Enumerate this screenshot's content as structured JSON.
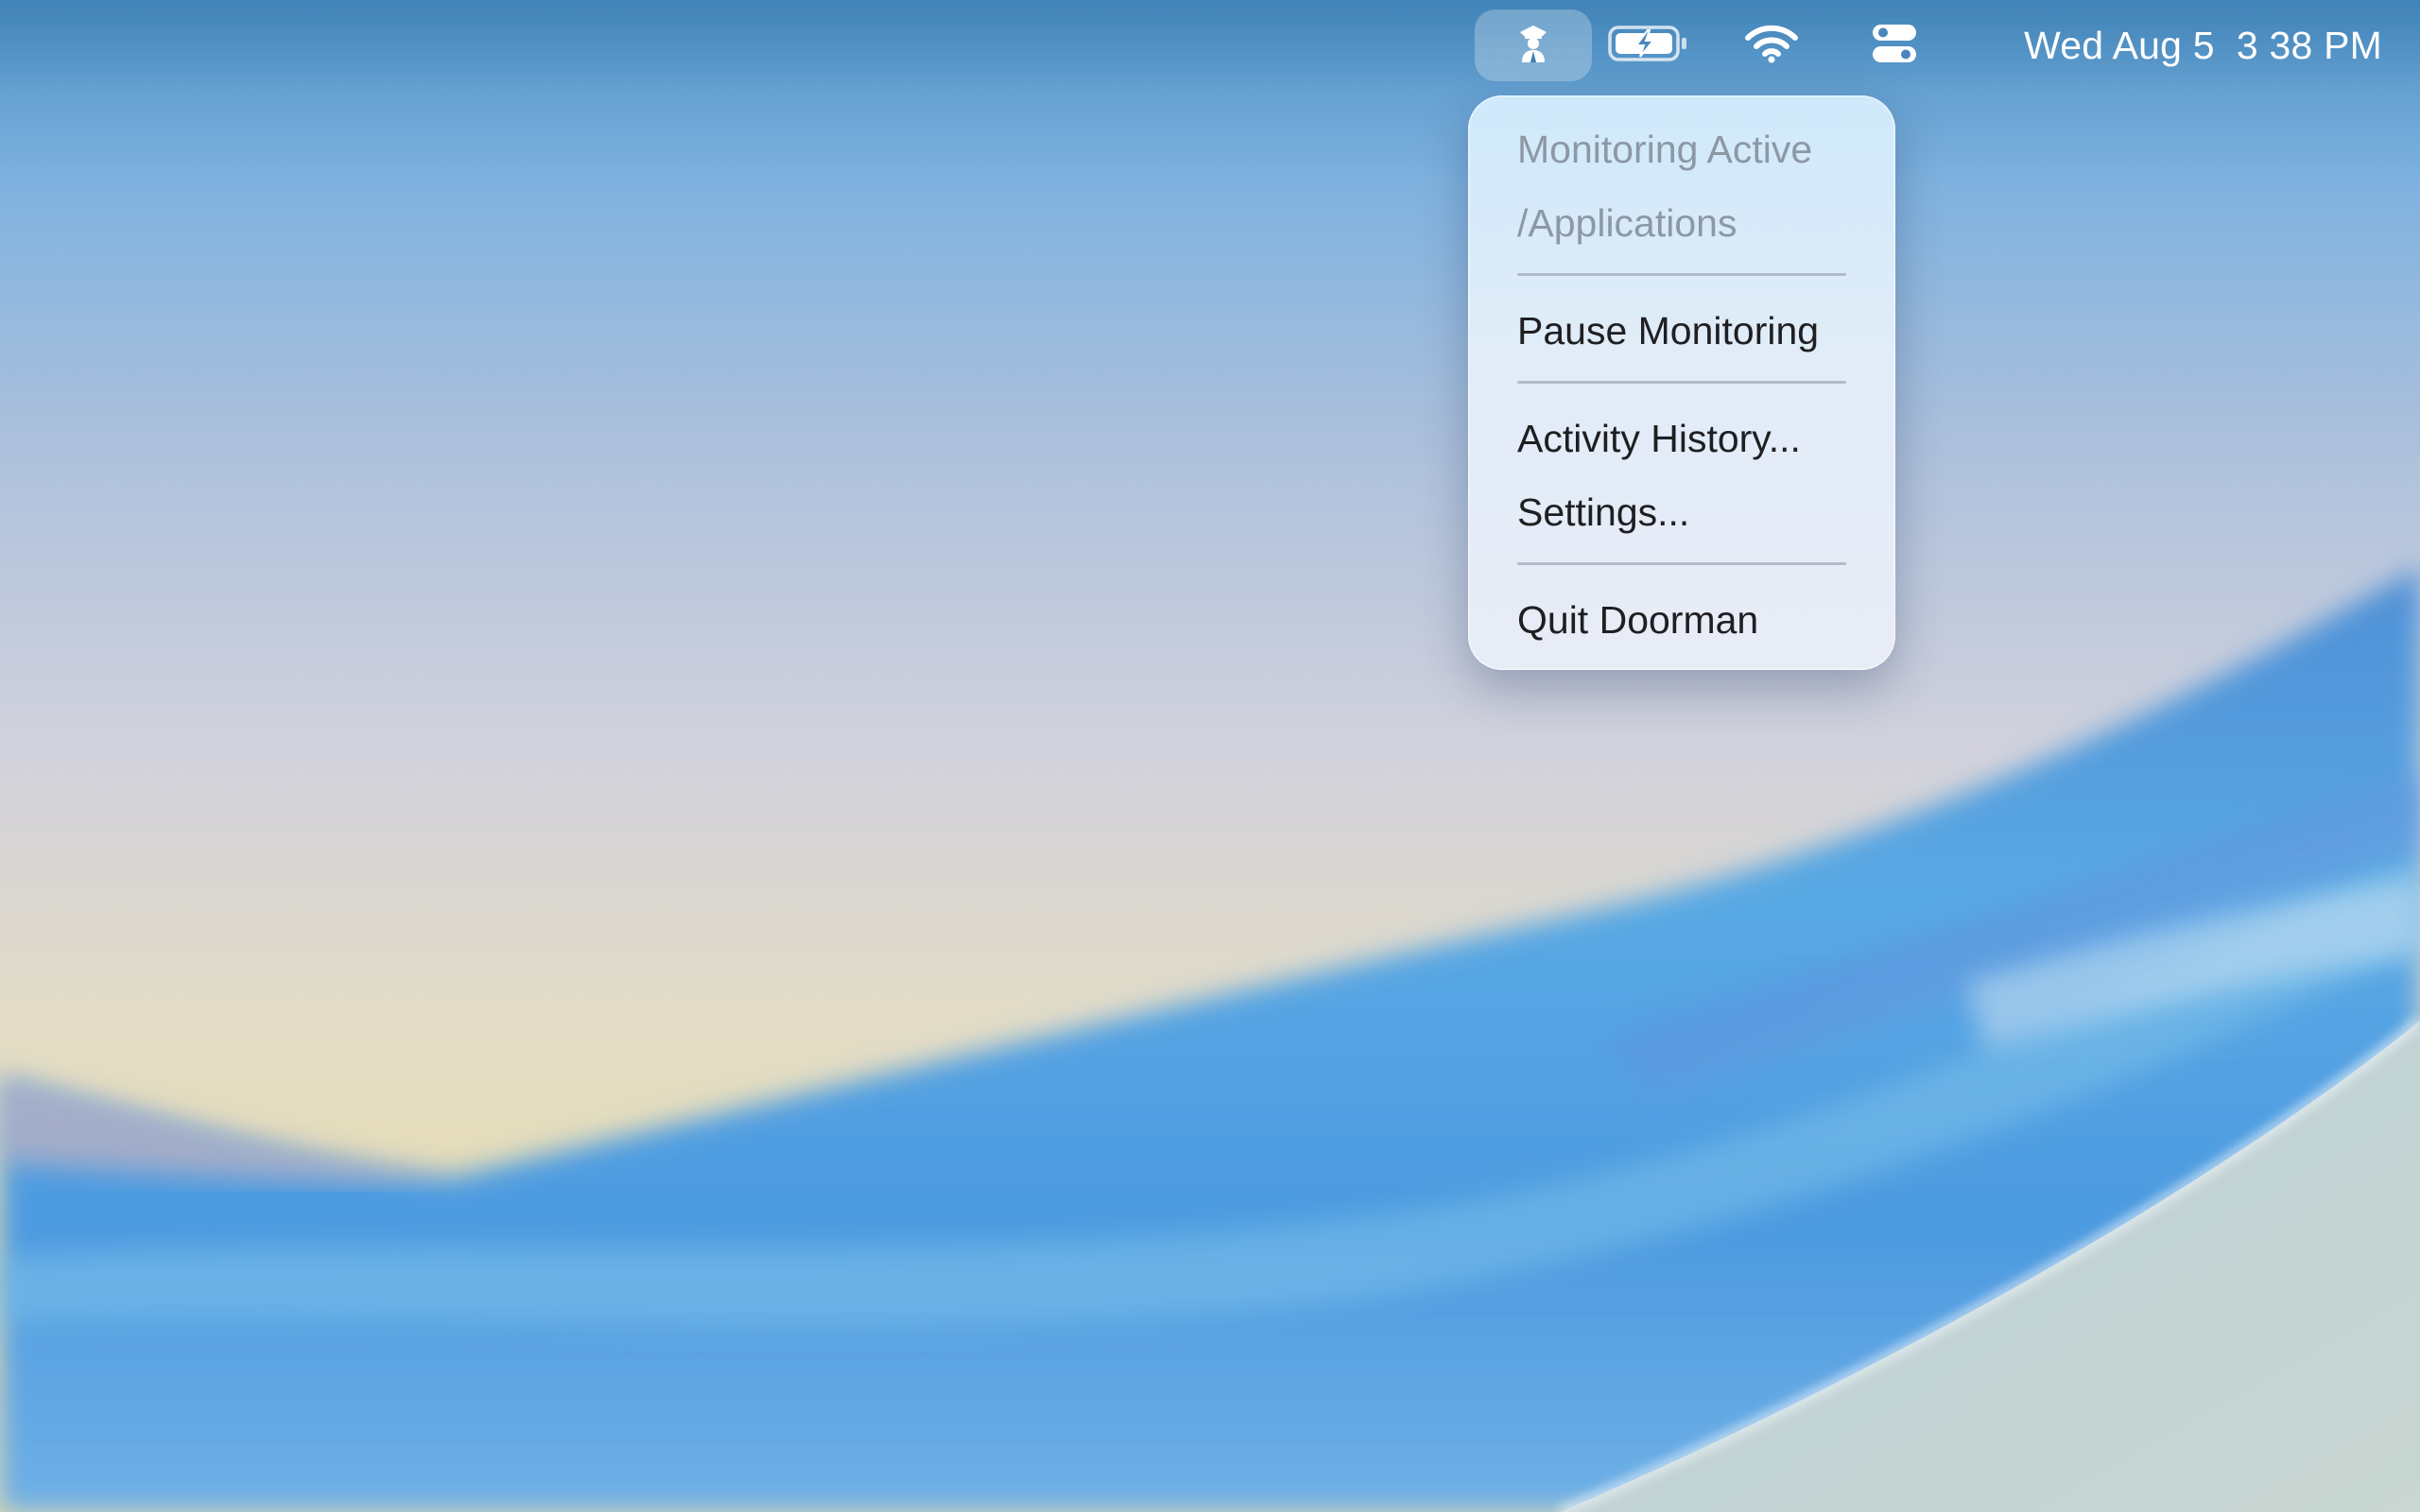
{
  "menubar": {
    "app_icon": "doorman-figure-icon",
    "battery_icon": "battery-charging-icon",
    "wifi_icon": "wifi-icon",
    "control_center_icon": "control-center-icon",
    "clock": "Wed Aug 5  3 38 PM"
  },
  "menu": {
    "status_label": "Monitoring Active",
    "path_label": "/Applications",
    "pause_label": "Pause Monitoring",
    "history_label": "Activity History...",
    "settings_label": "Settings...",
    "quit_label": "Quit Doorman"
  },
  "colors": {
    "menu_text": "#1f1f22",
    "menu_disabled_text": "#8c98a5",
    "menubar_text": "#ffffff"
  }
}
